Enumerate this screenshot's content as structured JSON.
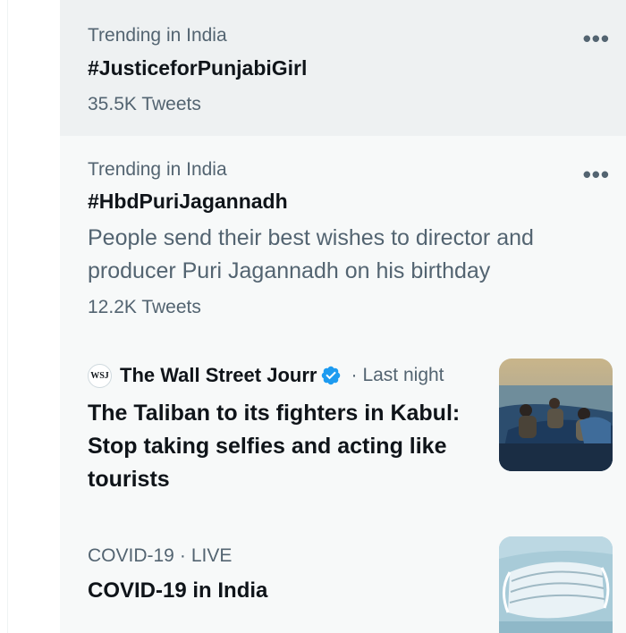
{
  "trends": [
    {
      "context": "Trending in India",
      "title": "#JusticeforPunjabiGirl",
      "count": "35.5K Tweets"
    },
    {
      "context": "Trending in India",
      "title": "#HbdPuriJagannadh",
      "description": "People send their best wishes to director and producer Puri Jagannadh on his birthday",
      "count": "12.2K Tweets"
    }
  ],
  "news": {
    "logo_text": "WSJ",
    "source": "The Wall Street Jourr",
    "separator": "·",
    "time": "Last night",
    "headline": "The Taliban to its fighters in Kabul: Stop taking selfies and acting like tourists",
    "image": "boat-fighters-photo"
  },
  "covid": {
    "category": "COVID-19",
    "separator": "·",
    "status": "LIVE",
    "title": "COVID-19 in India",
    "image": "face-mask-photo"
  },
  "more_icon": "more-horizontal-icon",
  "colors": {
    "panel_bg": "#f7f9f9",
    "hover_bg": "#eef1f2",
    "primary_text": "#0f1419",
    "secondary_text": "#536471",
    "verified_blue": "#1d9bf0"
  }
}
